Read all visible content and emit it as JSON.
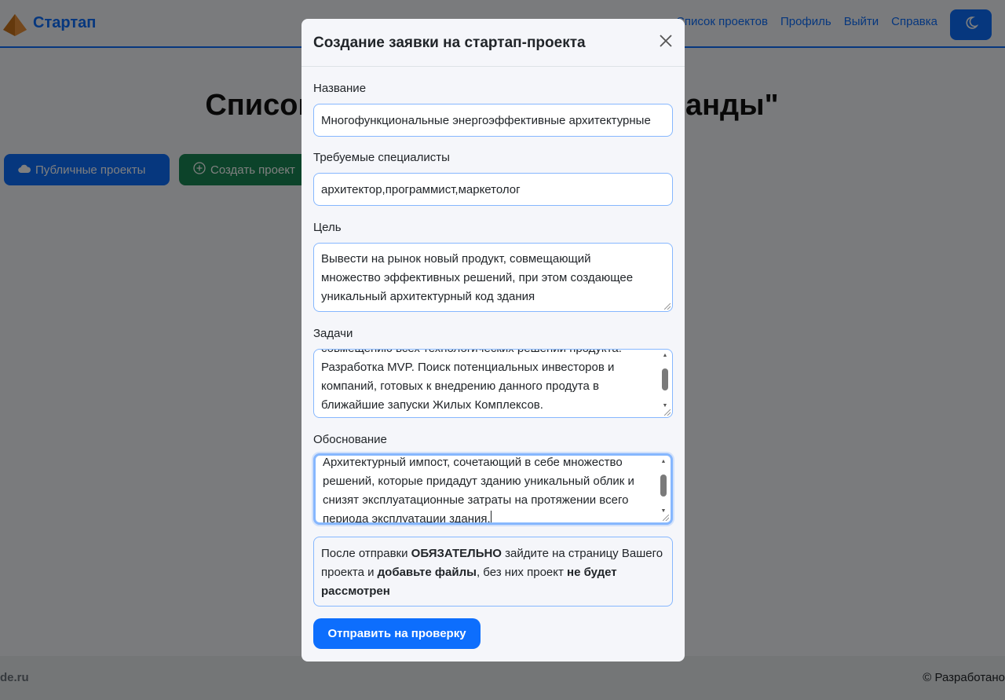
{
  "navbar": {
    "brand": "Стартап",
    "links": [
      "Список проектов",
      "Профиль",
      "Выйти",
      "Справка"
    ],
    "theme_icon": "moon-icon"
  },
  "page": {
    "title": "Список проектов \"Создание команды\"",
    "public_button": "Публичные проекты",
    "create_button": "Создать проект"
  },
  "footer": {
    "left": "de.ru",
    "right": "© Разработано"
  },
  "modal": {
    "title": "Создание заявки на стартап-проекта",
    "fields": {
      "name": {
        "label": "Название",
        "value": "Многофункциональные энергоэффективные архитектурные"
      },
      "specialists": {
        "label": "Требуемые специалисты",
        "value": "архитектор,программист,маркетолог"
      },
      "goal": {
        "label": "Цель",
        "lines": [
          "Вывести на рынок новый продукт, совмещающий",
          "множество эффективных решений, при этом создающее",
          "уникальный архитектурный код здания"
        ]
      },
      "tasks": {
        "label": "Задачи",
        "lines": [
          "совмещению всех технологических решений продукта.",
          "Разработка MVP. Поиск потенциальных инвесторов и",
          "компаний, готовых к внедрению данного продута в",
          "ближайшие запуски Жилых Комплексов."
        ]
      },
      "justification": {
        "label": "Обоснование",
        "lines": [
          "Архитектурный импост, сочетающий в себе множество",
          "решений, которые придадут зданию уникальный облик и",
          "снизят эксплуатационные затраты на протяжении всего",
          "периода эксплуатации здания."
        ]
      }
    },
    "notice": {
      "t1": "После отправки ",
      "b1": "ОБЯЗАТЕЛЬНО",
      "t2": " зайдите на страницу Вашего проекта и ",
      "b2": "добавьте файлы",
      "t3": ", без них проект ",
      "b3": "не будет рассмотрен"
    },
    "submit": "Отправить на проверку"
  }
}
